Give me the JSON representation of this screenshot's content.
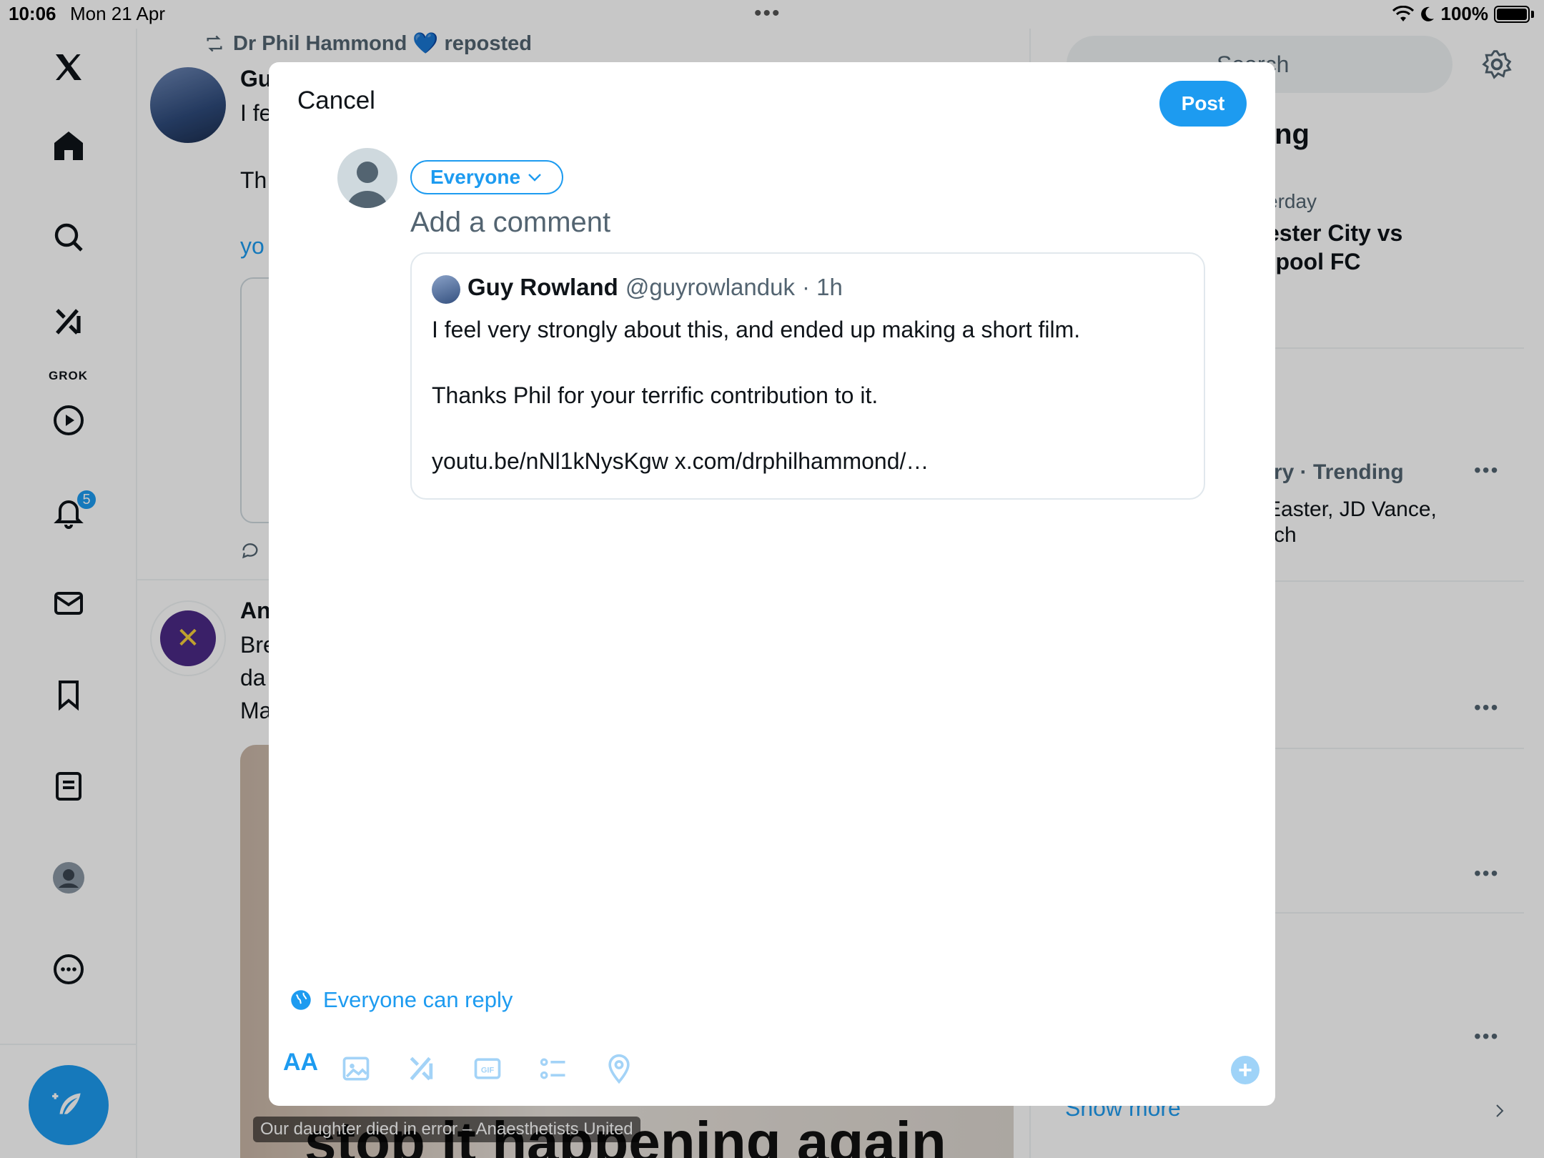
{
  "status_bar": {
    "time": "10:06",
    "date": "Mon 21 Apr",
    "battery": "100%"
  },
  "nav": {
    "grok_label": "GROK",
    "notifications_badge": "5"
  },
  "feed": {
    "repost_author": "Dr Phil Hammond 💙 reposted",
    "post1_name_fragment": "Gu",
    "post1_line1_fragment": "I fe",
    "post1_line2_fragment": "Th",
    "post1_line3_fragment": "yo",
    "post2_name_fragment": "An",
    "post2_line1_fragment": "Bre",
    "post2_line2_fragment": "da",
    "post2_line3_fragment": "Ma",
    "video_caption": "Our daughter died in error – Anaesthetists United",
    "video_overlay_text": "stop it happening again"
  },
  "right_column": {
    "search_placeholder": "Search",
    "trending_title_fragment": "ing",
    "item1_meta": "erday",
    "item1_title_line1": "ester City vs",
    "item1_title_line2": "rpool FC",
    "item2_meta": "try · Trending",
    "item2_desc_line1": "Easter, JD Vance,",
    "item2_desc_line2": "rch",
    "show_more": "Show more"
  },
  "modal": {
    "cancel_label": "Cancel",
    "post_label": "Post",
    "audience_label": "Everyone",
    "comment_placeholder": "Add a comment",
    "quoted": {
      "name": "Guy Rowland",
      "handle": "@guyrowlanduk",
      "time": "· 1h",
      "line1": "I feel very strongly about this, and ended up making a short film.",
      "line2": "Thanks Phil for your terrific contribution to it.",
      "line3": "youtu.be/nNl1kNysKgw x.com/drphilhammond/…"
    },
    "reply_setting": "Everyone can reply",
    "toolbar": {
      "text_format_label": "AA",
      "gif_label": "GIF"
    }
  },
  "colors": {
    "accent": "#1d9bf0",
    "text_primary": "#0f1419",
    "text_secondary": "#536471"
  }
}
